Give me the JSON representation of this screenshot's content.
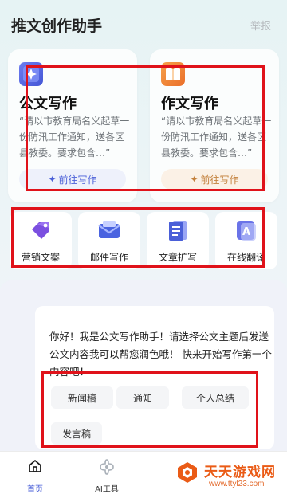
{
  "header": {
    "title": "推文创作助手",
    "report": "举报"
  },
  "cards": [
    {
      "title": "公文写作",
      "desc": "“请以市教育局名义起草一份防汛工作通知，送各区县教委。要求包含…”",
      "button": "前往写作",
      "accent": "#4a5fd8"
    },
    {
      "title": "作文写作",
      "desc": "“请以市教育局名义起草一份防汛工作通知，送各区县教委。要求包含…”",
      "button": "前往写作",
      "accent": "#c3803b"
    }
  ],
  "tools": [
    {
      "label": "营销文案",
      "icon": "tag-icon"
    },
    {
      "label": "邮件写作",
      "icon": "envelope-icon"
    },
    {
      "label": "文章扩写",
      "icon": "document-icon"
    },
    {
      "label": "在线翻译",
      "icon": "translate-icon"
    }
  ],
  "chat": {
    "welcome": "你好！我是公文写作助手！请选择公文主题后发送公文内容我可以帮您润色哦！ 快来开始写作第一个内容吧！",
    "chips": [
      "新闻稿",
      "通知",
      "个人总结",
      "发言稿"
    ]
  },
  "nav": [
    {
      "label": "首页",
      "icon": "home-icon",
      "active": true
    },
    {
      "label": "AI工具",
      "icon": "ai-tools-icon",
      "active": false
    }
  ],
  "watermark": {
    "name": "天天游戏网",
    "url": "www.ttyl23.com"
  },
  "colors": {
    "highlight": "#e0121a",
    "primary": "#4a5fd8",
    "accent": "#c3803b"
  }
}
